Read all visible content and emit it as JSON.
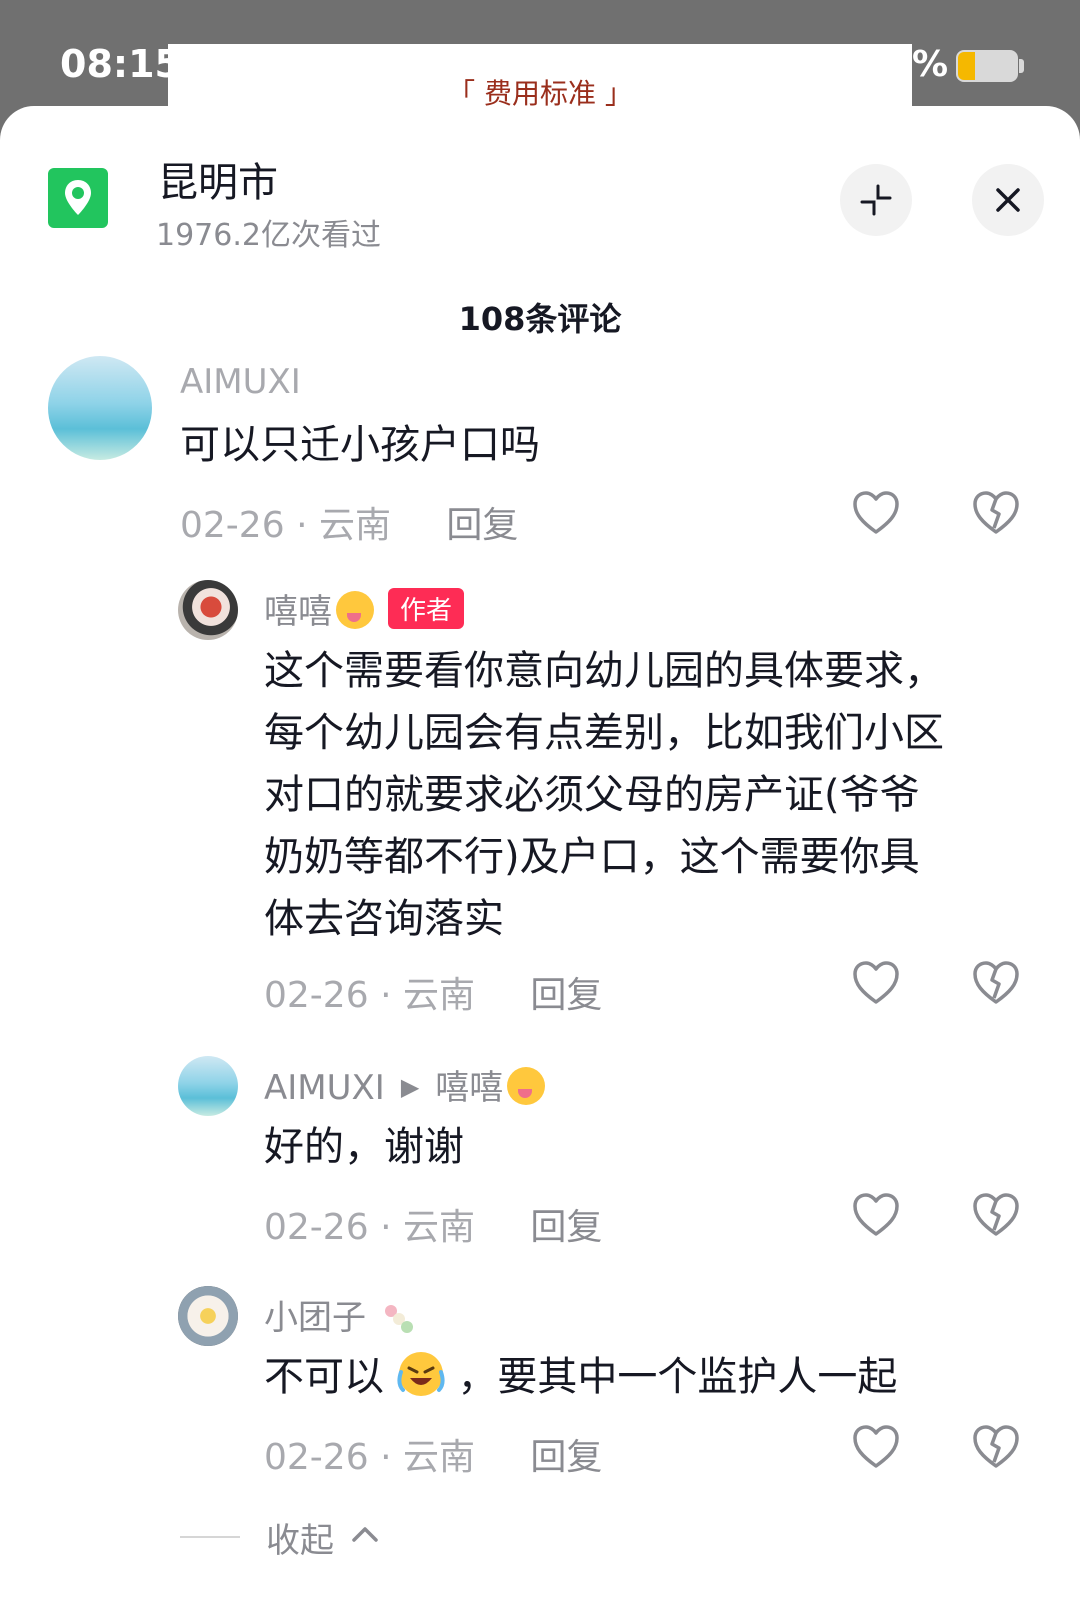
{
  "status_bar": {
    "time": "08:15",
    "battery_suffix": "%",
    "battery_level": 0.3,
    "battery_color": "#f5b800"
  },
  "background_page": {
    "title": "「 费用标准 」"
  },
  "header": {
    "location_icon": "location-pin-icon",
    "location_name": "昆明市",
    "views": "1976.2亿次看过",
    "minimize_icon": "minimize-icon",
    "close_icon": "close-icon"
  },
  "comment_count": "108条评论",
  "comments": [
    {
      "username": "AIMUXI",
      "text": "可以只迁小孩户口吗",
      "date": "02-26",
      "region": "云南",
      "reply_label": "回复"
    },
    {
      "username": "嘻嘻",
      "badge": "作者",
      "text": "这个需要看你意向幼儿园的具体要求，\n每个幼儿园会有点差别，比如我们小区\n对口的就要求必须父母的房产证(爷爷\n奶奶等都不行)及户口，这个需要你具\n体去咨询落实",
      "date": "02-26",
      "region": "云南",
      "reply_label": "回复"
    },
    {
      "username": "AIMUXI",
      "reply_to": "嘻嘻",
      "text": "好的，谢谢",
      "date": "02-26",
      "region": "云南",
      "reply_label": "回复"
    },
    {
      "username": "小团子",
      "text_before_emoji": "不可以",
      "text_after_emoji": "，要其中一个监护人一起",
      "date": "02-26",
      "region": "云南",
      "reply_label": "回复"
    }
  ],
  "collapse_label": "收起",
  "colors": {
    "accent": "#fe2c55",
    "location_green": "#22c55e",
    "muted_text": "#8a8b91",
    "bg_title": "#9a2e1c"
  },
  "icons": {
    "like": "heart-icon",
    "dislike": "broken-heart-icon",
    "collapse": "chevron-up-icon"
  }
}
